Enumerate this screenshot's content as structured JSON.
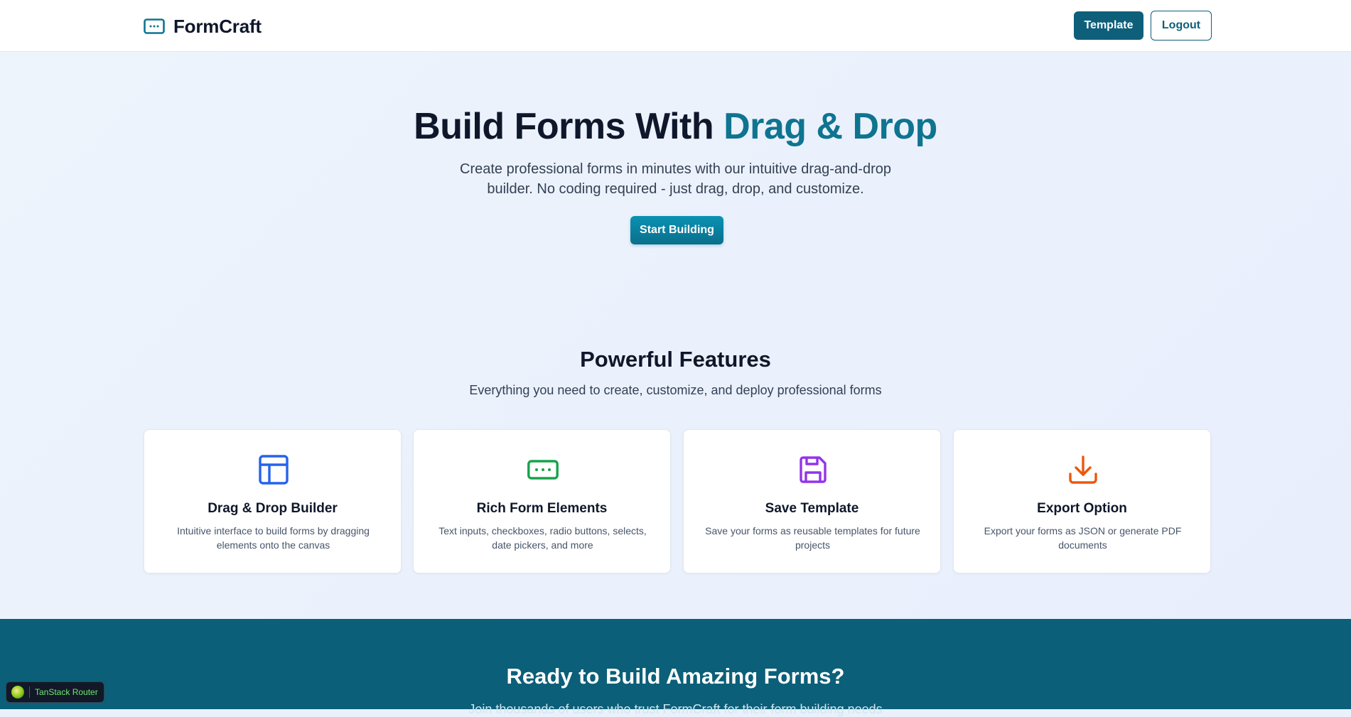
{
  "app": {
    "name": "FormCraft"
  },
  "nav": {
    "template_label": "Template",
    "logout_label": "Logout"
  },
  "hero": {
    "title_main": "Build Forms With ",
    "title_accent": "Drag & Drop",
    "subtitle": "Create professional forms in minutes with our intuitive drag-and-drop builder. No coding required - just drag, drop, and customize.",
    "cta_label": "Start Building"
  },
  "features": {
    "title": "Powerful Features",
    "subtitle": "Everything you need to create, customize, and deploy professional forms",
    "cards": [
      {
        "icon": "layout-icon",
        "color": "#2563eb",
        "title": "Drag & Drop Builder",
        "description": "Intuitive interface to build forms by dragging elements onto the canvas"
      },
      {
        "icon": "input-field-icon",
        "color": "#16a34a",
        "title": "Rich Form Elements",
        "description": "Text inputs, checkboxes, radio buttons, selects, date pickers, and more"
      },
      {
        "icon": "save-icon",
        "color": "#9333ea",
        "title": "Save Template",
        "description": "Save your forms as reusable templates for future projects"
      },
      {
        "icon": "download-icon",
        "color": "#ea580c",
        "title": "Export Option",
        "description": "Export your forms as JSON or generate PDF documents"
      }
    ]
  },
  "cta": {
    "title": "Ready to Build Amazing Forms?",
    "subtitle": "Join thousands of users who trust FormCraft for their form building needs"
  },
  "devtools": {
    "label": "TanStack Router"
  },
  "colors": {
    "brand": "#0e7490",
    "primary_button": "#0e5f7a",
    "cta_background": "#0b5f78"
  }
}
